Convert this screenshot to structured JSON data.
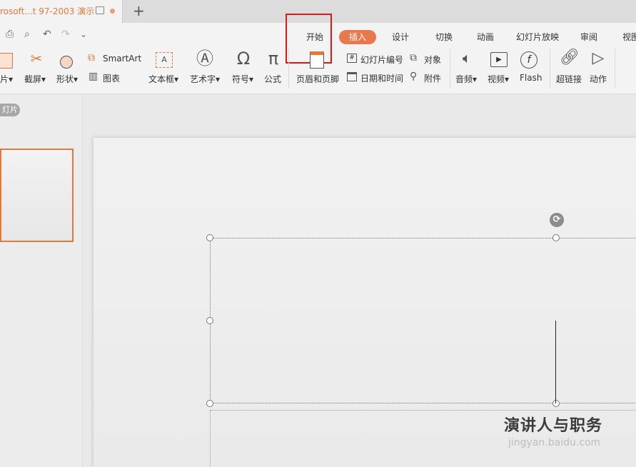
{
  "document_tab": {
    "title": "rosoft...t 97-2003 演示"
  },
  "new_tab_label": "+",
  "quick_access": {
    "print": "⎙",
    "preview": "⌕",
    "undo": "↶",
    "redo": "↷",
    "more": "⌄"
  },
  "ribbon_tabs": [
    "开始",
    "插入",
    "设计",
    "切换",
    "动画",
    "幻灯片放映",
    "审阅",
    "视图"
  ],
  "ribbon_groups": {
    "picture": "片▾",
    "screenshot": "截屏▾",
    "shapes": "形状▾",
    "smartart": "SmartArt",
    "chart": "图表",
    "textbox": "文本框▾",
    "wordart": "艺术字▾",
    "symbol": "符号▾",
    "formula": "公式",
    "header_footer": "页眉和页脚",
    "slide_number": "幻灯片编号",
    "date_time": "日期和时间",
    "object": "对象",
    "attachment": "附件",
    "audio": "音频▾",
    "video": "视频▾",
    "flash": "Flash",
    "hyperlink": "超链接",
    "action": "动作"
  },
  "left_panel": {
    "label": "灯片"
  },
  "watermark": {
    "text": "演讲人与职务",
    "site": "jingyan.baidu.com"
  },
  "colors": {
    "accent": "#e8794c",
    "highlight": "#e01818"
  }
}
